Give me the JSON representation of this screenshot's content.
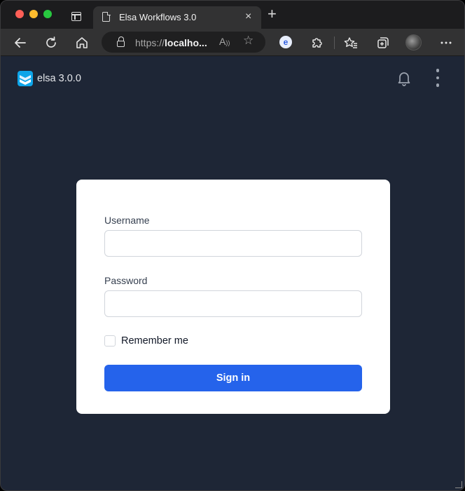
{
  "browser": {
    "tab_title": "Elsa Workflows 3.0",
    "tab_close_glyph": "×",
    "new_tab_glyph": "+",
    "url_scheme": "https://",
    "url_host": "localho...",
    "read_aloud_glyph": "A",
    "icons": [
      "back-icon",
      "refresh-icon",
      "home-icon",
      "lock-icon",
      "read-aloud-icon",
      "add-favorite-icon",
      "extension-icon",
      "favorites-icon",
      "collections-icon",
      "profile-avatar",
      "more-icon"
    ]
  },
  "app": {
    "brand": "elsa 3.0.0",
    "background_color": "#1e2636",
    "logo_color": "#0ea5e9"
  },
  "login": {
    "username_label": "Username",
    "username_value": "",
    "password_label": "Password",
    "password_value": "",
    "remember_label": "Remember me",
    "remember_checked": false,
    "signin_label": "Sign in",
    "button_color": "#2563eb"
  }
}
